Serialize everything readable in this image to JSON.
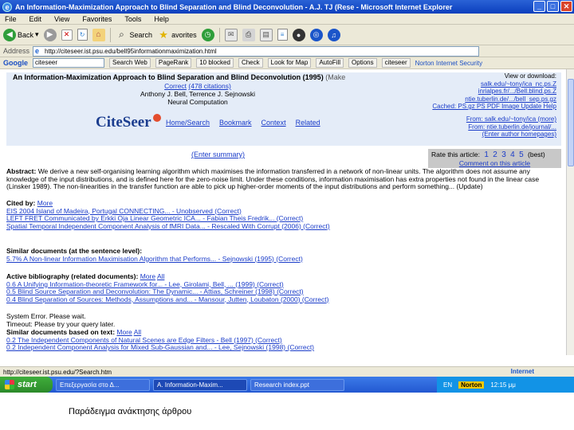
{
  "window": {
    "title": "An Information-Maximization Approach to Blind Separation and Blind Deconvolution - A.J. TJ (Rese - Microsoft Internet Explorer"
  },
  "menu": [
    "File",
    "Edit",
    "View",
    "Favorites",
    "Tools",
    "Help"
  ],
  "toolbar": {
    "back": "Back",
    "search": "Search",
    "favorites": "avorites"
  },
  "address": {
    "label": "Address",
    "url": "http://citeseer.ist.psu.edu/bell95informationmaximization.html"
  },
  "google_bar": {
    "logo": "Google",
    "query": "citeseer",
    "items": [
      "Search Web",
      "PageRank",
      "10 blocked",
      "Check",
      "Look for Map",
      "AutoFill",
      "Options",
      "citeseer"
    ],
    "security": "Norton Internet Security"
  },
  "page": {
    "title": "An Information-Maximization Approach to Blind Separation and Blind Deconvolution (1995)",
    "title_marker": "(Make",
    "correct_link": "Correct",
    "citations_link": "(478 citations)",
    "authors": "Anthony J. Bell, Terrence J. Sejnowski",
    "venue": "Neural Computation",
    "right_links": [
      "View or download:",
      "salk.edu/~tony/ica_nc.ps.Z",
      "inrialpes.fr/.../Bell.blind.ps.Z",
      "ntie.tuberlin.de/.../bell_sep.ps.gz",
      "Cached: PS.gz  PS  PDF  Image  Update  Help"
    ],
    "logo": "CiteSeer",
    "nav": [
      "Home/Search",
      "Bookmark",
      "Context",
      "Related"
    ],
    "from_lines": [
      "From: salk.edu/~tony/ica (more)",
      "From: ntie.tuberlin.de/journal/...",
      "(Enter author homepages)"
    ],
    "context_link": "(Enter summary)",
    "rate": {
      "label": "Rate this article:",
      "nums": [
        "1",
        "2",
        "3",
        "4",
        "5"
      ],
      "best": "(best)",
      "comment": "Comment on this article"
    },
    "abstract_label": "Abstract:",
    "abstract": "We derive a new self-organising learning algorithm which maximises the information transferred in a network of non-linear units. The algorithm does not assume any knowledge of the input distributions, and is defined here for the zero-noise limit. Under these conditions, information maximisation has extra properties not found in the linear case (Linsker 1989). The non-linearities in the transfer function are able to pick up higher-order moments of the input distributions and perform something... (Update)",
    "cited_by": {
      "head": "Cited by:",
      "more": "More",
      "rows": [
        "EIS 2004 Island of Madeira, Portugal CONNECTING... - Unobserved    (Correct)",
        "LEFT FRET Communicated by Erkki Oja Linear Geometric ICA... - Fabian Theis Fredrik...    (Correct)",
        "Spatial Temporal Independent Component Analysis of fMRI Data... - Rescaled With Corrupt (2006)    (Correct)"
      ]
    },
    "similar": {
      "head": "Similar documents (at the sentence level):",
      "rows": [
        "5.7%  A Non-linear Information Maximisation Algorithm that Performs... - Sejnowski (1995)    (Correct)"
      ]
    },
    "biblio": {
      "head": "Active bibliography (related documents):",
      "more": "More",
      "all": "All",
      "rows": [
        "0.6   A Unifying Information-theoretic Framework for... - Lee, Girolami, Bell, ... (1999)    (Correct)",
        "0.5   Blind Source Separation and Deconvolution: The Dynamic... - Attias, Schreiner (1998)    (Correct)",
        "0.4   Blind Separation of Sources: Methods, Assumptions and... - Mansour, Jutten, Loubaton (2000)    (Correct)"
      ]
    },
    "system": [
      "System Error. Please wait.",
      "Timeout: Please try your query later."
    ],
    "similar_text": {
      "head": "Similar documents based on text:",
      "more": "More",
      "all": "All",
      "rows": [
        "0.2   The Independent Components of Natural Scenes are Edge Filters - Bell (1997)    (Correct)",
        "0.2   Independent Component Analysis for Mixed Sub-Gaussian and... - Lee, Sejnowski (1998)    (Correct)"
      ]
    }
  },
  "status": {
    "text": "http://citeseer.ist.psu.edu/?Search.htm",
    "zone": "Internet"
  },
  "taskbar": {
    "start": "start",
    "tasks": [
      "Επεξεργασία στο Δ...",
      "A. Information-Maxim...",
      "Research index.ppt"
    ],
    "tray": {
      "lang": "EN",
      "norton": "Norton",
      "time": "12:15 μμ"
    }
  },
  "caption": "Παράδειγμα ανάκτησης άρθρου"
}
